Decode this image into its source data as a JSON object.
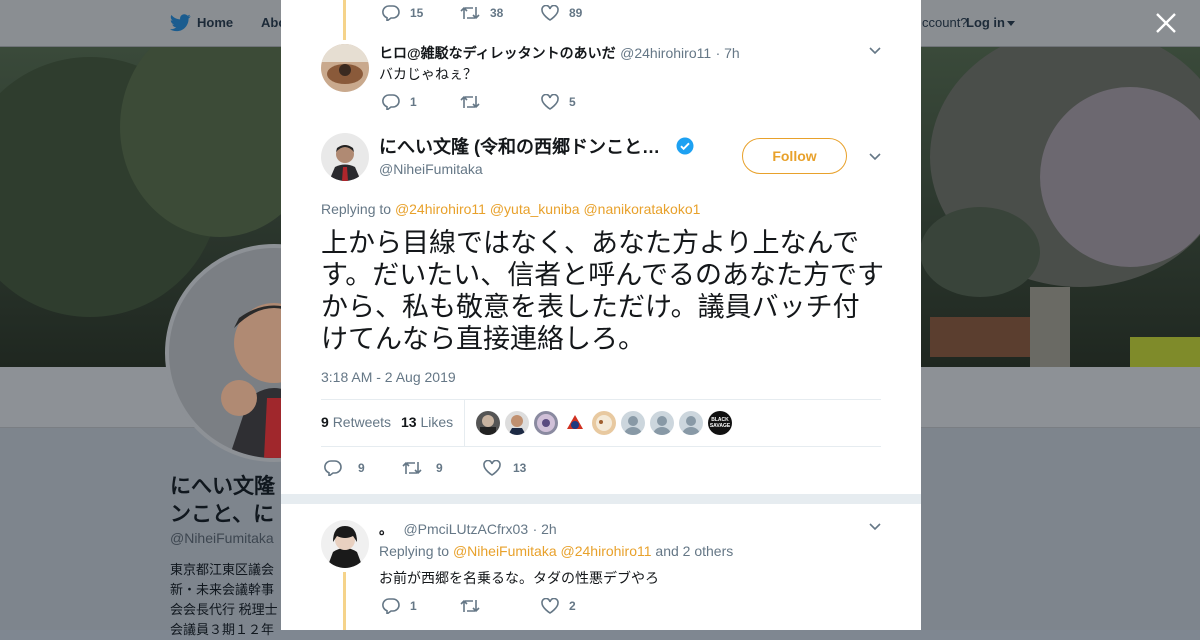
{
  "background": {
    "nav": {
      "home": "Home",
      "about": "Abo"
    },
    "account_prompt": "ccount?",
    "login": "Log in",
    "name_lines": [
      "にへい文隆",
      "ンこと、に"
    ],
    "handle": "@NiheiFumitaka",
    "bio_lines": [
      "東京都江東区議会",
      "新・未来会議幹事",
      "会会長代行 税理士",
      "会議員３期１２年"
    ]
  },
  "modal": {
    "prev_reply_actions": {
      "replies": "15",
      "retweets": "38",
      "likes": "89"
    },
    "reply1": {
      "name": "ヒロ@雑駁なディレッタントのあいだ",
      "handle": "@24hirohiro11",
      "time": "· 7h",
      "text": "バカじゃねぇ？",
      "replies": "1",
      "retweets": "",
      "likes": "5"
    },
    "main": {
      "name": "にへい文隆 (令和の西郷ドンこと…",
      "handle": "@NiheiFumitaka",
      "follow_label": "Follow",
      "replying_prefix": "Replying to",
      "replying_to": [
        "@24hirohiro11",
        "@yuta_kuniba",
        "@nanikoratakoko1"
      ],
      "text": "上から目線ではなく、あなた方より上なんです。だいたい、信者と呼んでるのあなた方ですから、私も敬意を表しただけ。議員バッチ付けてんなら直接連絡しろ。",
      "timestamp": "3:18 AM - 2 Aug 2019",
      "retweets_count": "9",
      "retweets_label": "Retweets",
      "likes_count": "13",
      "likes_label": "Likes",
      "actions": {
        "replies": "9",
        "retweets": "9",
        "likes": "13"
      },
      "liker_badge_text": "BLACK SAVAGE"
    },
    "reply2": {
      "name": "。",
      "handle": "@PmciLUtzACfrx03",
      "time": "· 2h",
      "replying_prefix": "Replying to",
      "replying_to": [
        "@NiheiFumitaka",
        "@24hirohiro11"
      ],
      "replying_suffix": "and 2 others",
      "text": "お前が西郷を名乗るな。タダの性悪デブやろ",
      "replies": "1",
      "retweets": "",
      "likes": "2"
    }
  },
  "colors": {
    "accent": "#e8a12b",
    "verified": "#1da1f2",
    "thread_line": "#f5d38a",
    "muted": "#657786"
  },
  "icons": [
    "twitter-bird-icon",
    "close-icon",
    "reply-icon",
    "retweet-icon",
    "like-icon",
    "chevron-down-icon",
    "verified-badge-icon",
    "caret-down-icon"
  ]
}
